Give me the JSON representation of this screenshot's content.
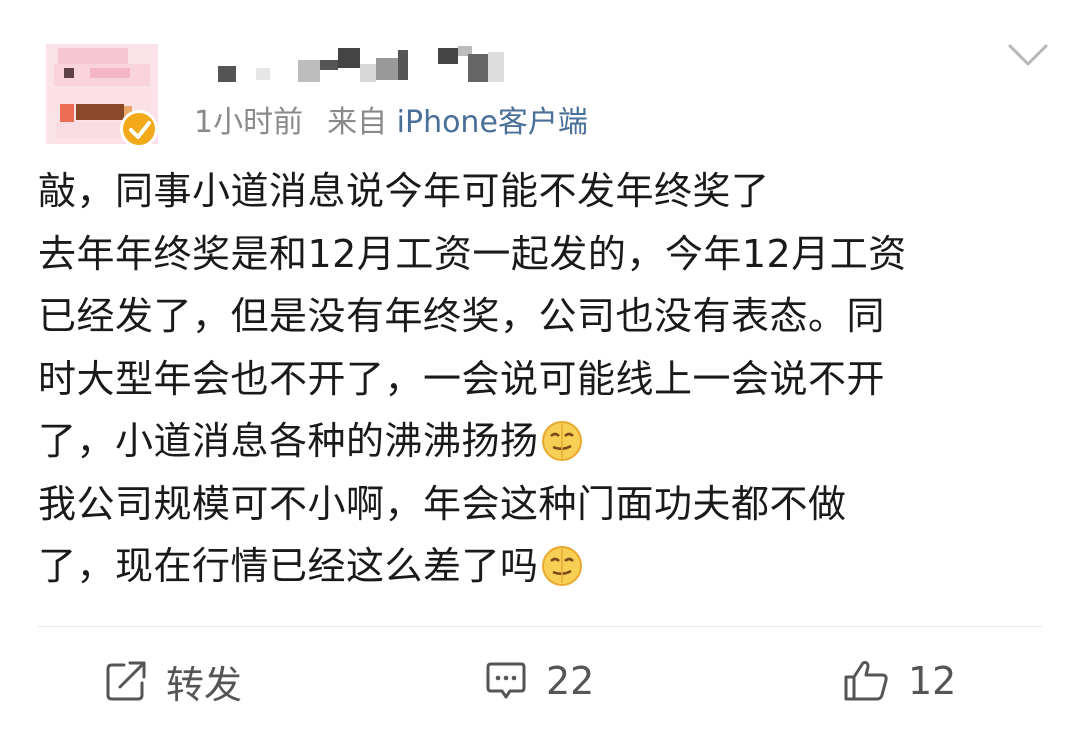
{
  "post": {
    "timestamp": "1小时前",
    "from_prefix": "来自",
    "source": "iPhone客户端",
    "content_lines": [
      "敲，同事小道消息说今年可能不发年终奖了",
      "去年年终奖是和12月工资一起发的，今年12月工资",
      "已经发了，但是没有年终奖，公司也没有表态。同",
      "时大型年会也不开了，一会说可能线上一会说不开",
      "了，小道消息各种的沸沸扬扬",
      "我公司规模可不小啊，年会这种门面功夫都不做",
      "了，现在行情已经这么差了吗"
    ],
    "emojis": [
      "smirk-face-emoji",
      "smirk-face-emoji"
    ]
  },
  "actions": {
    "repost_label": "转发",
    "comment_count": "22",
    "like_count": "12"
  },
  "icons": {
    "expand": "chevron-down-icon",
    "repost": "share-arrow-icon",
    "comment": "comment-bubble-icon",
    "like": "thumbs-up-icon",
    "verified": "verified-check-badge-icon"
  },
  "colors": {
    "meta_gray": "#8a8a8a",
    "source_blue": "#4a6f99",
    "verified_orange": "#f3aa1a",
    "text": "#1a1a1a",
    "action_gray": "#555555"
  }
}
